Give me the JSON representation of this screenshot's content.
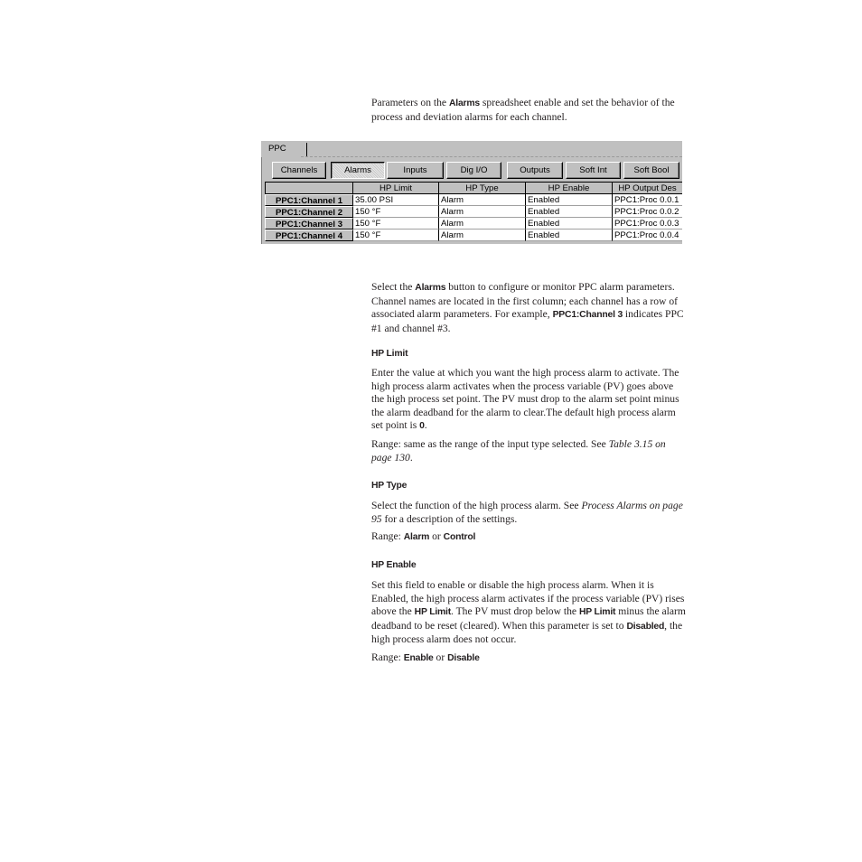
{
  "intro": {
    "pre": "Parameters on the ",
    "bold": "Alarms",
    "post": " spreadsheet enable and set the behavior of the process and deviation alarms for each channel."
  },
  "app": {
    "tab": "PPC",
    "buttons": [
      {
        "label": "Channels",
        "active": false
      },
      {
        "label": "Alarms",
        "active": true
      },
      {
        "label": "Inputs",
        "active": false
      },
      {
        "label": "Dig I/O",
        "active": false
      },
      {
        "label": "Outputs",
        "active": false
      },
      {
        "label": "Soft Int",
        "active": false
      },
      {
        "label": "Soft Bool",
        "active": false
      }
    ],
    "columns": [
      "",
      "HP Limit",
      "HP Type",
      "HP Enable",
      "HP Output Des"
    ],
    "rows": [
      {
        "name": "PPC1:Channel 1",
        "hp_limit": "35.00 PSI",
        "hp_type": "Alarm",
        "hp_enable": "Enabled",
        "hp_output": "PPC1:Proc 0.0.1"
      },
      {
        "name": "PPC1:Channel 2",
        "hp_limit": "150  °F",
        "hp_type": "Alarm",
        "hp_enable": "Enabled",
        "hp_output": "PPC1:Proc 0.0.2"
      },
      {
        "name": "PPC1:Channel 3",
        "hp_limit": "150  °F",
        "hp_type": "Alarm",
        "hp_enable": "Enabled",
        "hp_output": "PPC1:Proc 0.0.3"
      },
      {
        "name": "PPC1:Channel 4",
        "hp_limit": "150  °F",
        "hp_type": "Alarm",
        "hp_enable": "Enabled",
        "hp_output": "PPC1:Proc 0.0.4"
      }
    ]
  },
  "select_para": {
    "a": "Select the ",
    "b": "Alarms",
    "c": " button to configure or monitor PPC alarm parameters. Channel names are located in the first column; each channel has a row of associated alarm parameters. For example, ",
    "d": "PPC1:Channel 3",
    "e": " indicates PPC #1 and channel #3."
  },
  "hp_limit": {
    "heading": "HP Limit",
    "body_a": "Enter the value at which you want the high process alarm to activate. The high process alarm activates when the process variable (PV) goes above the high process set point. The PV must drop to the alarm set point minus the alarm deadband for the alarm to clear.The default high process alarm set point is ",
    "body_b": "0",
    "body_c": ".",
    "range_a": "Range: same as the range of the input type selected. See ",
    "range_ref": "Table 3.15 on page 130",
    "range_c": "."
  },
  "hp_type": {
    "heading": "HP Type",
    "body_a": "Select the function of the high process alarm. See ",
    "body_ref": "Process Alarms on page 95",
    "body_c": " for a description of the settings.",
    "range_a": "Range: ",
    "opt1": "Alarm",
    "or": " or ",
    "opt2": "Control"
  },
  "hp_enable": {
    "heading": "HP Enable",
    "a": "Set this field to enable or disable the high process alarm. When it is Enabled, the high process alarm activates if the process variable (PV) rises above the ",
    "b": "HP Limit",
    "c": ". The PV must drop below the ",
    "d": "HP Limit",
    "e": " minus the alarm deadband to be reset (cleared). When this parameter is set to ",
    "f": "Disabled",
    "g": ", the high process alarm does not occur.",
    "range_a": "Range: ",
    "opt1": "Enable",
    "or": " or ",
    "opt2": "Disable"
  }
}
